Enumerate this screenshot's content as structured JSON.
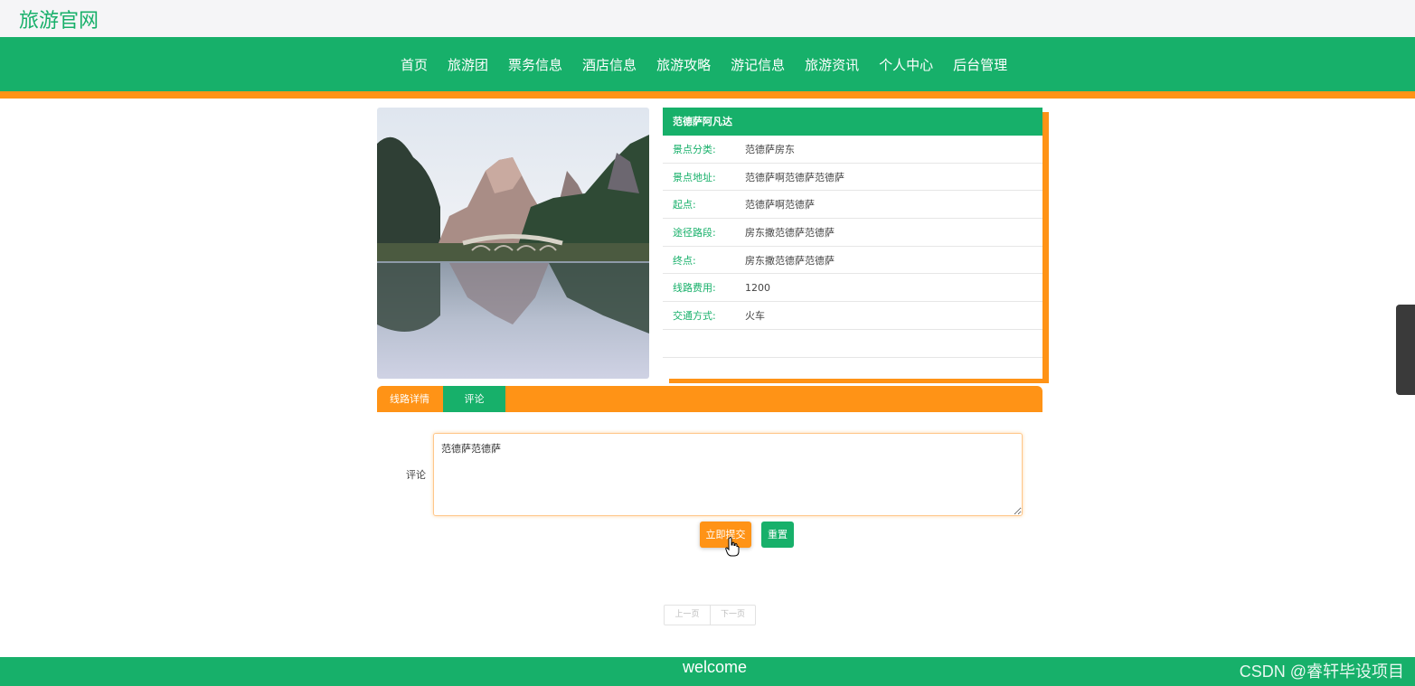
{
  "site": {
    "title": "旅游官网"
  },
  "nav": {
    "items": [
      "首页",
      "旅游团",
      "票务信息",
      "酒店信息",
      "旅游攻略",
      "游记信息",
      "旅游资讯",
      "个人中心",
      "后台管理"
    ]
  },
  "attraction": {
    "name": "范德萨阿凡达",
    "fields": [
      {
        "label": "景点分类:",
        "value": "范德萨房东"
      },
      {
        "label": "景点地址:",
        "value": "范德萨啊范德萨范德萨"
      },
      {
        "label": "起点:",
        "value": "范德萨啊范德萨"
      },
      {
        "label": "途径路段:",
        "value": "房东撒范德萨范德萨"
      },
      {
        "label": "终点:",
        "value": "房东撒范德萨范德萨"
      },
      {
        "label": "线路费用:",
        "value": "1200"
      },
      {
        "label": "交通方式:",
        "value": "火车"
      }
    ]
  },
  "tabs": {
    "detail": "线路详情",
    "comment": "评论"
  },
  "comment_form": {
    "label": "评论",
    "value": "范德萨范德萨",
    "submit_label": "立即提交",
    "reset_label": "重置"
  },
  "pagination": {
    "prev": "上一页",
    "next": "下一页"
  },
  "footer": {
    "text": "welcome",
    "watermark": "CSDN @睿轩毕设项目"
  },
  "colors": {
    "primary_green": "#17b06a",
    "accent_orange": "#ff9316"
  }
}
